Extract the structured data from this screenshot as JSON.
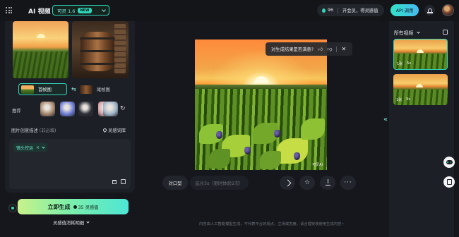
{
  "header": {
    "app_title": "AI 视频",
    "model_name": "可灵 1.6",
    "model_badge": "NEW",
    "credit_value": "96",
    "membership_text": "开会员，得灵感值",
    "api_button": "API 调用"
  },
  "left_panel": {
    "first_frame_label": "首帧图",
    "last_frame_label": "尾帧图",
    "recommend_label": "推荐",
    "description_label": "图片创意描述",
    "description_optional": "(非必填)",
    "inspiration_link": "灵感词库",
    "camera_tag": "镜头控运",
    "generate_button": "立即生成",
    "generate_cost": "35 灵感值",
    "consume_detail": "灵感值消耗明细"
  },
  "recommend_thumbs": [
    {
      "color": "#a9896f"
    },
    {
      "color": "#6f7fd8"
    },
    {
      "color": "#2b2e36"
    },
    {
      "color": "#d8a3a8"
    },
    {
      "color": "#9fb4c8"
    }
  ],
  "main": {
    "feedback_question": "对生成结果是否满意?",
    "watermark": "可灵AI",
    "portrait_button": "对口型",
    "extend_button": "延长5s（限时体验2次）",
    "footer_note": "内容由人工智能模型生成，不代表平台的观点、立场或态度，请合理安装使用生成内容~"
  },
  "right_panel": {
    "title": "所有视频",
    "videos": [
      {
        "count": "1张",
        "duration": "5s"
      },
      {
        "count": "1张",
        "duration": "5s"
      }
    ]
  },
  "icons": [
    "menu-icon",
    "chevron-down-icon",
    "water-drop-icon",
    "bell-icon",
    "swap-icon",
    "refresh-icon",
    "pin-icon",
    "trash-icon",
    "edit-icon",
    "thumb-up-icon",
    "thumb-down-icon",
    "close-icon",
    "send-icon",
    "star-icon",
    "download-icon",
    "more-icon",
    "expand-left-icon",
    "copy-icon",
    "robot-icon",
    "document-icon"
  ],
  "colors": {
    "accent": "#2fd6b8",
    "background": "#15171c",
    "panel": "#1c1f25"
  }
}
